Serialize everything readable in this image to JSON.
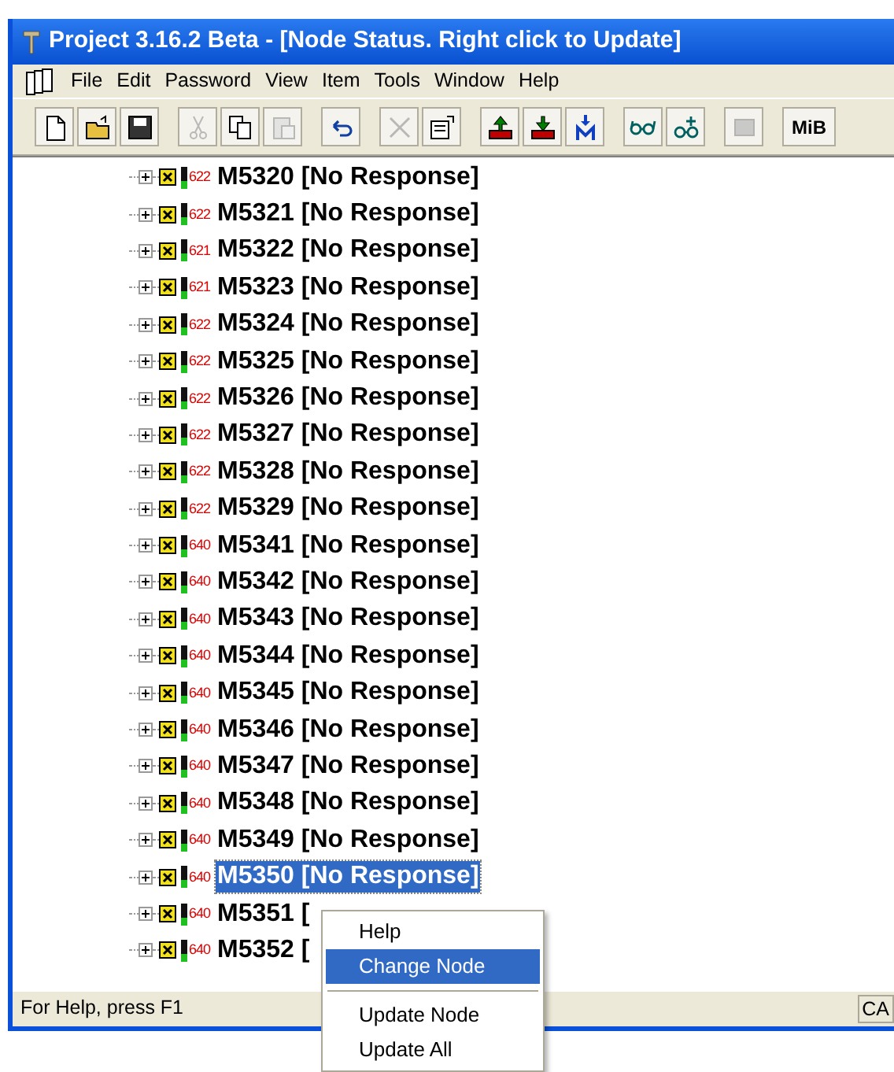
{
  "window": {
    "title": "Project 3.16.2 Beta - [Node Status. Right click to Update]"
  },
  "menu_bar": [
    "File",
    "Edit",
    "Password",
    "View",
    "Item",
    "Tools",
    "Window",
    "Help"
  ],
  "toolbar": [
    {
      "kind": "new"
    },
    {
      "kind": "open"
    },
    {
      "kind": "save"
    },
    {
      "kind": "sep"
    },
    {
      "kind": "cut",
      "disabled": true
    },
    {
      "kind": "copy",
      "disabled": false
    },
    {
      "kind": "paste",
      "disabled": true
    },
    {
      "kind": "sep"
    },
    {
      "kind": "undo"
    },
    {
      "kind": "sep"
    },
    {
      "kind": "delete",
      "disabled": true
    },
    {
      "kind": "properties"
    },
    {
      "kind": "sep"
    },
    {
      "kind": "upload"
    },
    {
      "kind": "download"
    },
    {
      "kind": "download-m"
    },
    {
      "kind": "sep"
    },
    {
      "kind": "glasses"
    },
    {
      "kind": "glasses-plus"
    },
    {
      "kind": "sep"
    },
    {
      "kind": "grey",
      "disabled": true
    },
    {
      "kind": "sep"
    },
    {
      "kind": "text",
      "label": "MiB"
    }
  ],
  "tree": [
    {
      "code": "622",
      "label": "M5320 [No Response]",
      "selected": false
    },
    {
      "code": "622",
      "label": "M5321 [No Response]",
      "selected": false
    },
    {
      "code": "621",
      "label": "M5322 [No Response]",
      "selected": false
    },
    {
      "code": "621",
      "label": "M5323 [No Response]",
      "selected": false
    },
    {
      "code": "622",
      "label": "M5324 [No Response]",
      "selected": false
    },
    {
      "code": "622",
      "label": "M5325 [No Response]",
      "selected": false
    },
    {
      "code": "622",
      "label": "M5326 [No Response]",
      "selected": false
    },
    {
      "code": "622",
      "label": "M5327 [No Response]",
      "selected": false
    },
    {
      "code": "622",
      "label": "M5328 [No Response]",
      "selected": false
    },
    {
      "code": "622",
      "label": "M5329 [No Response]",
      "selected": false
    },
    {
      "code": "640",
      "label": "M5341 [No Response]",
      "selected": false
    },
    {
      "code": "640",
      "label": "M5342 [No Response]",
      "selected": false
    },
    {
      "code": "640",
      "label": "M5343 [No Response]",
      "selected": false
    },
    {
      "code": "640",
      "label": "M5344 [No Response]",
      "selected": false
    },
    {
      "code": "640",
      "label": "M5345 [No Response]",
      "selected": false
    },
    {
      "code": "640",
      "label": "M5346 [No Response]",
      "selected": false
    },
    {
      "code": "640",
      "label": "M5347 [No Response]",
      "selected": false
    },
    {
      "code": "640",
      "label": "M5348 [No Response]",
      "selected": false
    },
    {
      "code": "640",
      "label": "M5349 [No Response]",
      "selected": false
    },
    {
      "code": "640",
      "label": "M5350 [No Response]",
      "selected": true
    },
    {
      "code": "640",
      "label": "M5351 [",
      "selected": false
    },
    {
      "code": "640",
      "label": "M5352 [",
      "selected": false
    }
  ],
  "status_bar": {
    "text": "For Help, press F1",
    "indicator": "CA"
  },
  "context_menu": [
    {
      "kind": "item",
      "label": "Help",
      "selected": false
    },
    {
      "kind": "item",
      "label": "Change Node",
      "selected": true
    },
    {
      "kind": "separator"
    },
    {
      "kind": "item",
      "label": "Update Node",
      "selected": false
    },
    {
      "kind": "item",
      "label": "Update All",
      "selected": false
    }
  ]
}
